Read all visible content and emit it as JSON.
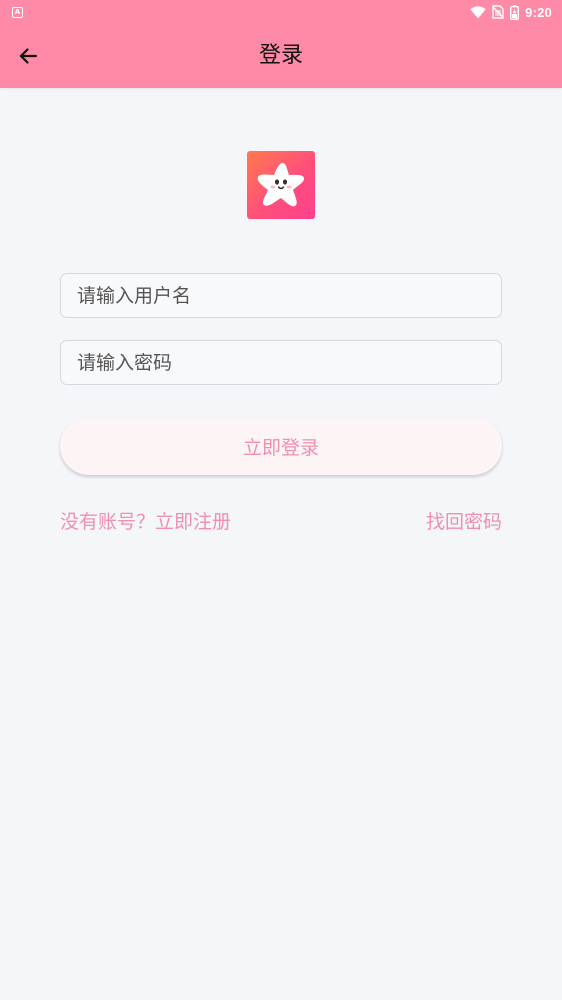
{
  "status_bar": {
    "time": "9:20",
    "notification_icon": "a-badge-icon",
    "icons": [
      "wifi-icon",
      "no-sim-icon",
      "battery-icon"
    ],
    "background": "#ff8aa7"
  },
  "header": {
    "title": "登录",
    "back_icon": "back-arrow-icon",
    "background": "#ff8aa7"
  },
  "logo": {
    "icon": "star-mascot-icon"
  },
  "form": {
    "username_placeholder": "请输入用户名",
    "username_value": "",
    "password_placeholder": "请输入密码",
    "password_value": "",
    "login_label": "立即登录"
  },
  "links": {
    "register": "没有账号？立即注册",
    "forgot": "找回密码"
  },
  "colors": {
    "accent": "#f08fb0",
    "page_background": "#f5f6f9"
  }
}
